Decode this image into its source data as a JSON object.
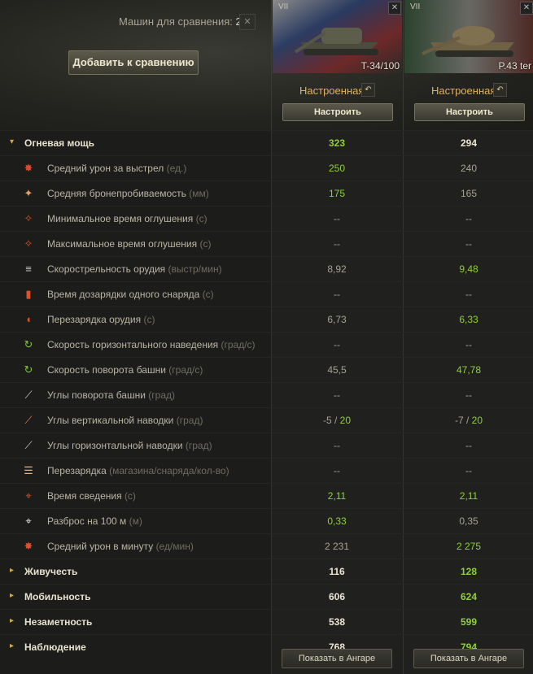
{
  "header": {
    "compare_label": "Машин для сравнения:",
    "compare_count": "2",
    "count_close": "✕",
    "add_button": "Добавить к сравнению"
  },
  "vehicles": [
    {
      "tier": "VII",
      "name": "T-34/100",
      "state": "Настроенная",
      "configure": "Настроить",
      "show_in_hangar": "Показать в Ангаре",
      "close": "✕",
      "undo": "↶"
    },
    {
      "tier": "VII",
      "name": "P.43 ter",
      "state": "Настроенная",
      "configure": "Настроить",
      "show_in_hangar": "Показать в Ангаре",
      "close": "✕",
      "undo": "↶"
    }
  ],
  "rows": [
    {
      "type": "header",
      "label": "Огневая мощь",
      "unit": "",
      "arrow": "▾",
      "v1": "323",
      "v2": "294",
      "g1": true,
      "g2": false,
      "icon": "firepower-icon",
      "glyph": ""
    },
    {
      "type": "item",
      "label": "Средний урон за выстрел",
      "unit": "(ед.)",
      "v1": "250",
      "v2": "240",
      "g1": true,
      "g2": false,
      "icon": "damage-icon",
      "glyph": "✸"
    },
    {
      "type": "item",
      "label": "Средняя бронепробиваемость",
      "unit": "(мм)",
      "v1": "175",
      "v2": "165",
      "g1": true,
      "g2": false,
      "icon": "penetration-icon",
      "glyph": "✦"
    },
    {
      "type": "item",
      "label": "Минимальное время оглушения",
      "unit": "(с)",
      "v1": "--",
      "v2": "--",
      "g1": false,
      "g2": false,
      "icon": "stun-min-icon",
      "glyph": "✧"
    },
    {
      "type": "item",
      "label": "Максимальное время оглушения",
      "unit": "(с)",
      "v1": "--",
      "v2": "--",
      "g1": false,
      "g2": false,
      "icon": "stun-max-icon",
      "glyph": "✧"
    },
    {
      "type": "item",
      "label": "Скорострельность орудия",
      "unit": "(выстр/мин)",
      "v1": "8,92",
      "v2": "9,48",
      "g1": false,
      "g2": true,
      "icon": "rate-of-fire-icon",
      "glyph": "≡"
    },
    {
      "type": "item",
      "label": "Время дозарядки одного снаряда",
      "unit": "(с)",
      "v1": "--",
      "v2": "--",
      "g1": false,
      "g2": false,
      "icon": "shell-reload-icon",
      "glyph": "▮"
    },
    {
      "type": "item",
      "label": "Перезарядка орудия",
      "unit": "(с)",
      "v1": "6,73",
      "v2": "6,33",
      "g1": false,
      "g2": true,
      "icon": "reload-icon",
      "glyph": "◖"
    },
    {
      "type": "item",
      "label": "Скорость горизонтального наведения",
      "unit": "(град/с)",
      "v1": "--",
      "v2": "--",
      "g1": false,
      "g2": false,
      "icon": "traverse-speed-icon",
      "glyph": "↻"
    },
    {
      "type": "item",
      "label": "Скорость поворота башни",
      "unit": "(град/с)",
      "v1": "45,5",
      "v2": "47,78",
      "g1": false,
      "g2": true,
      "icon": "turret-rotation-icon",
      "glyph": "↻"
    },
    {
      "type": "item",
      "label": "Углы поворота башни",
      "unit": "(град)",
      "v1": "--",
      "v2": "--",
      "g1": false,
      "g2": false,
      "icon": "turret-angles-icon",
      "glyph": "⟋"
    },
    {
      "type": "item",
      "label": "Углы вертикальной наводки",
      "unit": "(град)",
      "v1": "-5",
      "v1b": "20",
      "v2": "-7",
      "v2b": "20",
      "g1": false,
      "g2": false,
      "icon": "elevation-icon",
      "glyph": "⟋"
    },
    {
      "type": "item",
      "label": "Углы горизонтальной наводки",
      "unit": "(град)",
      "v1": "--",
      "v2": "--",
      "g1": false,
      "g2": false,
      "icon": "horizontal-angles-icon",
      "glyph": "⟋"
    },
    {
      "type": "item",
      "label": "Перезарядка",
      "unit": "(магазина/снаряда/кол-во)",
      "v1": "--",
      "v2": "--",
      "g1": false,
      "g2": false,
      "icon": "magazine-icon",
      "glyph": "☰"
    },
    {
      "type": "item",
      "label": "Время сведения",
      "unit": "(с)",
      "v1": "2,11",
      "v2": "2,11",
      "g1": true,
      "g2": true,
      "icon": "aim-time-icon",
      "glyph": "⌖"
    },
    {
      "type": "item",
      "label": "Разброс на 100 м",
      "unit": "(м)",
      "v1": "0,33",
      "v2": "0,35",
      "g1": true,
      "g2": false,
      "icon": "dispersion-icon",
      "glyph": "⌖"
    },
    {
      "type": "item",
      "label": "Средний урон в минуту",
      "unit": "(ед/мин)",
      "v1": "2 231",
      "v2": "2 275",
      "g1": false,
      "g2": true,
      "icon": "dpm-icon",
      "glyph": "✸"
    },
    {
      "type": "header",
      "label": "Живучесть",
      "unit": "",
      "arrow": "▸",
      "v1": "116",
      "v2": "128",
      "g1": false,
      "g2": true,
      "icon": "survivability-icon",
      "glyph": ""
    },
    {
      "type": "header",
      "label": "Мобильность",
      "unit": "",
      "arrow": "▸",
      "v1": "606",
      "v2": "624",
      "g1": false,
      "g2": true,
      "icon": "mobility-icon",
      "glyph": ""
    },
    {
      "type": "header",
      "label": "Незаметность",
      "unit": "",
      "arrow": "▸",
      "v1": "538",
      "v2": "599",
      "g1": false,
      "g2": true,
      "icon": "camouflage-icon",
      "glyph": ""
    },
    {
      "type": "header",
      "label": "Наблюдение",
      "unit": "",
      "arrow": "▸",
      "v1": "768",
      "v2": "794",
      "g1": false,
      "g2": true,
      "icon": "spotting-icon",
      "glyph": ""
    }
  ],
  "colors": {
    "better": "#8fd13a",
    "normal": "#a6a294",
    "accent": "#e1b35b"
  }
}
